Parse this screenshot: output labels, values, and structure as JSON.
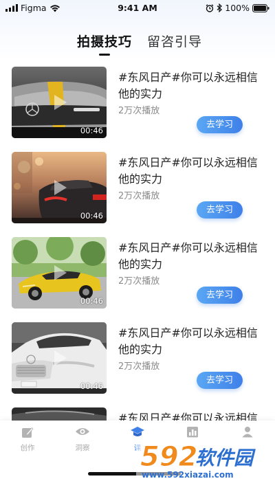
{
  "status_bar": {
    "carrier": "Figma",
    "time": "9:41 AM",
    "battery": "100%",
    "icons": [
      "signal-icon",
      "wifi-icon",
      "alarm-icon",
      "bluetooth-icon",
      "battery-icon"
    ]
  },
  "tabs": [
    {
      "label": "拍摄技巧",
      "active": true
    },
    {
      "label": "留咨引导",
      "active": false
    }
  ],
  "videos": [
    {
      "title": "#东风日产#你可以永远相信他的实力",
      "plays": "2万次播放",
      "duration": "00:46",
      "button": "去学习",
      "thumb": "grey-sedan"
    },
    {
      "title": "#东风日产#你可以永远相信他的实力",
      "plays": "2万次播放",
      "duration": "00:46",
      "button": "去学习",
      "thumb": "dark-car-street"
    },
    {
      "title": "#东风日产#你可以永远相信他的实力",
      "plays": "2万次播放",
      "duration": "00:46",
      "button": "去学习",
      "thumb": "yellow-sports-car"
    },
    {
      "title": "#东风日产#你可以永远相信他的实力",
      "plays": "2万次播放",
      "duration": "00:46",
      "button": "去学习",
      "thumb": "white-sedan"
    },
    {
      "title": "#东风日产#你可以永远相信他的实力",
      "plays": "",
      "duration": "",
      "button": "",
      "thumb": "dark-car"
    }
  ],
  "bottom_nav": [
    {
      "label": "创作",
      "icon": "edit-icon",
      "active": false
    },
    {
      "label": "洞察",
      "icon": "eye-icon",
      "active": false
    },
    {
      "label": "课",
      "icon": "graduation-cap-icon",
      "active": true
    },
    {
      "label": "",
      "icon": "chart-icon",
      "active": false
    },
    {
      "label": "",
      "icon": "user-icon",
      "active": false
    }
  ],
  "watermark": {
    "brand": "592软件园",
    "url": "www.592xiazai.com"
  },
  "colors": {
    "accent": "#3f80e9",
    "accent_light": "#5aa7f3",
    "watermark_orange": "#f08a1c",
    "watermark_blue": "#2d6fd0"
  }
}
